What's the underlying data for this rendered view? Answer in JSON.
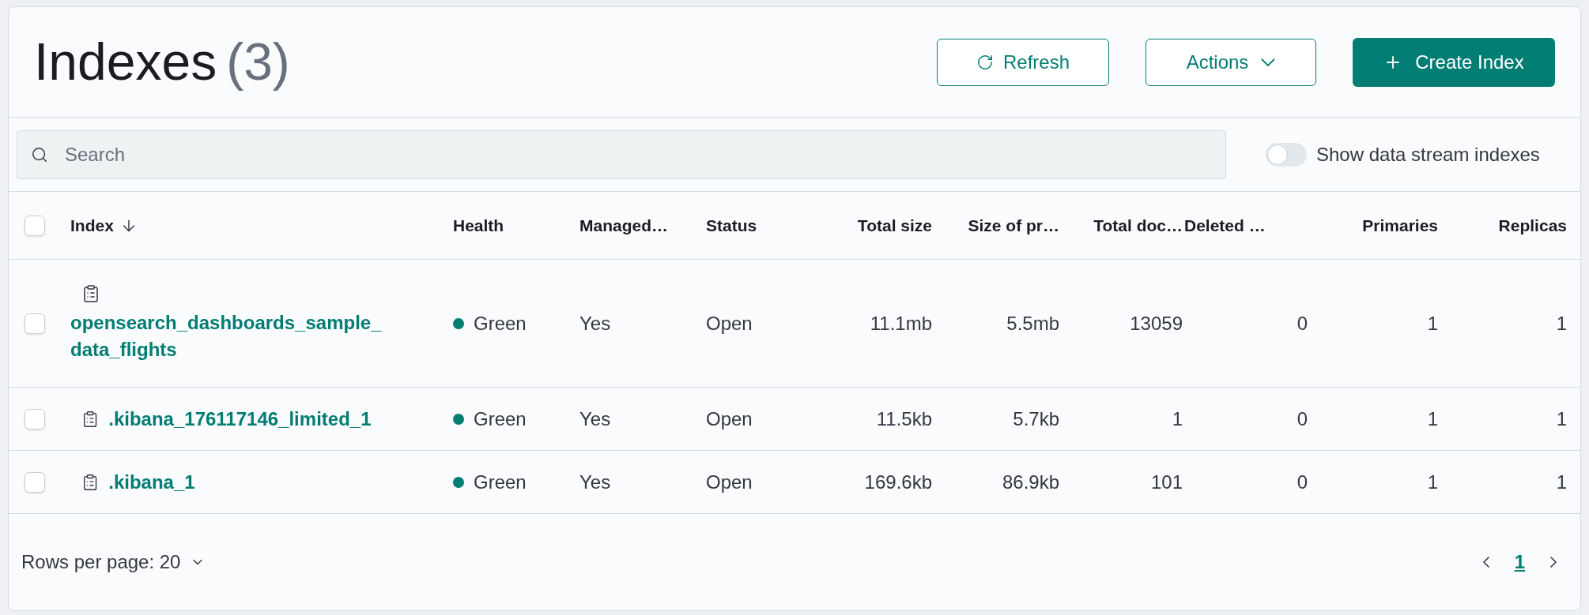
{
  "title": "Indexes",
  "count": "(3)",
  "buttons": [
    {
      "kind": "refresh",
      "label": "Refresh"
    },
    {
      "kind": "dropdown",
      "label": "Actions"
    },
    {
      "kind": "primary",
      "label": "Create Index"
    }
  ],
  "search": {
    "placeholder": "Search"
  },
  "toggle": {
    "label": "Show data stream indexes",
    "on": false
  },
  "table": {
    "select_all": {
      "checked": false
    },
    "columns": [
      {
        "label": "Index",
        "sorted": true
      },
      {
        "label": "Health",
        "sorted": false
      },
      {
        "label": "Managed…",
        "sorted": false
      },
      {
        "label": "Status",
        "sorted": false
      },
      {
        "label": "Total size",
        "sorted": false
      },
      {
        "label": "Size of pr…",
        "sorted": false
      },
      {
        "label": "Total doc…",
        "sorted": false
      },
      {
        "label": "Deleted …",
        "sorted": false
      },
      {
        "label": "Primaries",
        "sorted": false
      },
      {
        "label": "Replicas",
        "sorted": false
      }
    ],
    "rows": [
      {
        "checked": false,
        "icon_above": true,
        "index": "opensearch_dashboards_sample_ data_flights",
        "health": "Green",
        "color": "#017d73",
        "managed": "Yes",
        "status": "Open",
        "total_size": "11.1mb",
        "primary_size": "5.5mb",
        "total_docs": "13059",
        "deleted": "0",
        "primaries": "1",
        "replicas": "1"
      },
      {
        "checked": false,
        "icon_above": false,
        "index": ".kibana_176117146_limited_1",
        "health": "Green",
        "color": "#017d73",
        "managed": "Yes",
        "status": "Open",
        "total_size": "11.5kb",
        "primary_size": "5.7kb",
        "total_docs": "1",
        "deleted": "0",
        "primaries": "1",
        "replicas": "1"
      },
      {
        "checked": false,
        "icon_above": false,
        "index": ".kibana_1",
        "health": "Green",
        "color": "#017d73",
        "managed": "Yes",
        "status": "Open",
        "total_size": "169.6kb",
        "primary_size": "86.9kb",
        "total_docs": "101",
        "deleted": "0",
        "primaries": "1",
        "replicas": "1"
      }
    ]
  },
  "footer": {
    "rows_per_page": "Rows per page: 20",
    "pages": [
      {
        "label": "1",
        "selected": true
      }
    ]
  }
}
